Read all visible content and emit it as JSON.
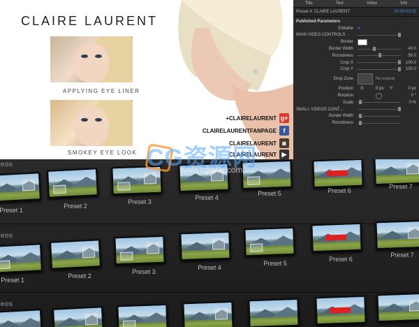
{
  "preview": {
    "brand": "CLAIRE LAURENT",
    "caption1": "APPLYING EYE LINER",
    "caption2": "SMOKEY EYE LOOK",
    "social": [
      {
        "text": "+CLAIRELAURENT",
        "icon": "google-plus-icon",
        "glyph": "g+",
        "color": "#d23c2a"
      },
      {
        "text": "CLAIRELAURENTFANPAGE",
        "icon": "facebook-icon",
        "glyph": "f",
        "color": "#3b5998"
      },
      {
        "text": "CLAIRELAURENT",
        "icon": "instagram-icon",
        "glyph": "◙",
        "color": "#4a3a30"
      },
      {
        "text": "CLAIRELAURENT",
        "icon": "youtube-icon",
        "glyph": "▶",
        "color": "#333"
      }
    ]
  },
  "inspector": {
    "tabs": [
      "Title",
      "Text",
      "Video",
      "Info"
    ],
    "header_title": "Preset 4: CLAIRE LAURENT",
    "timecode": "00:00:03:15",
    "published": "Published Parameters",
    "editable": "Editable",
    "main_controls": "MAIN VIDEO CONTROLS",
    "border": "Border",
    "border_width": "Border Width",
    "border_width_val": "40.0",
    "roundness": "Roundness",
    "roundness_val": "50.0",
    "crop_x": "Crop X",
    "crop_x_val": "100.0",
    "crop_y": "Crop Y",
    "crop_y_val": "100.0",
    "drop_zone": "Drop Zone",
    "no_source": "No source",
    "position": "Position",
    "pos_x": "X:",
    "pos_x_val": "0 px",
    "pos_y": "Y:",
    "pos_y_val": "0 px",
    "rotation": "Rotation",
    "rotation_val": "0 °",
    "scale": "Scale",
    "scale_val": "0 %",
    "small_controls": "SMALL VIDEOS CONT...",
    "border_width2": "Border Width",
    "roundness2": "Roundness"
  },
  "browser": {
    "group_label": "ideos",
    "rows": [
      [
        "Preset 1",
        "Preset 2",
        "Preset 3",
        "Preset 4",
        "Preset 5",
        "Preset 6",
        "Preset 7"
      ],
      [
        "Preset 1",
        "Preset 2",
        "Preset 3",
        "Preset 4",
        "Preset 5",
        "Preset 6",
        "Preset 7"
      ],
      [
        "",
        "",
        "",
        "",
        "",
        "",
        ""
      ]
    ]
  },
  "watermark": {
    "main": "CG资源网",
    "sub": "www.cgown.com"
  }
}
